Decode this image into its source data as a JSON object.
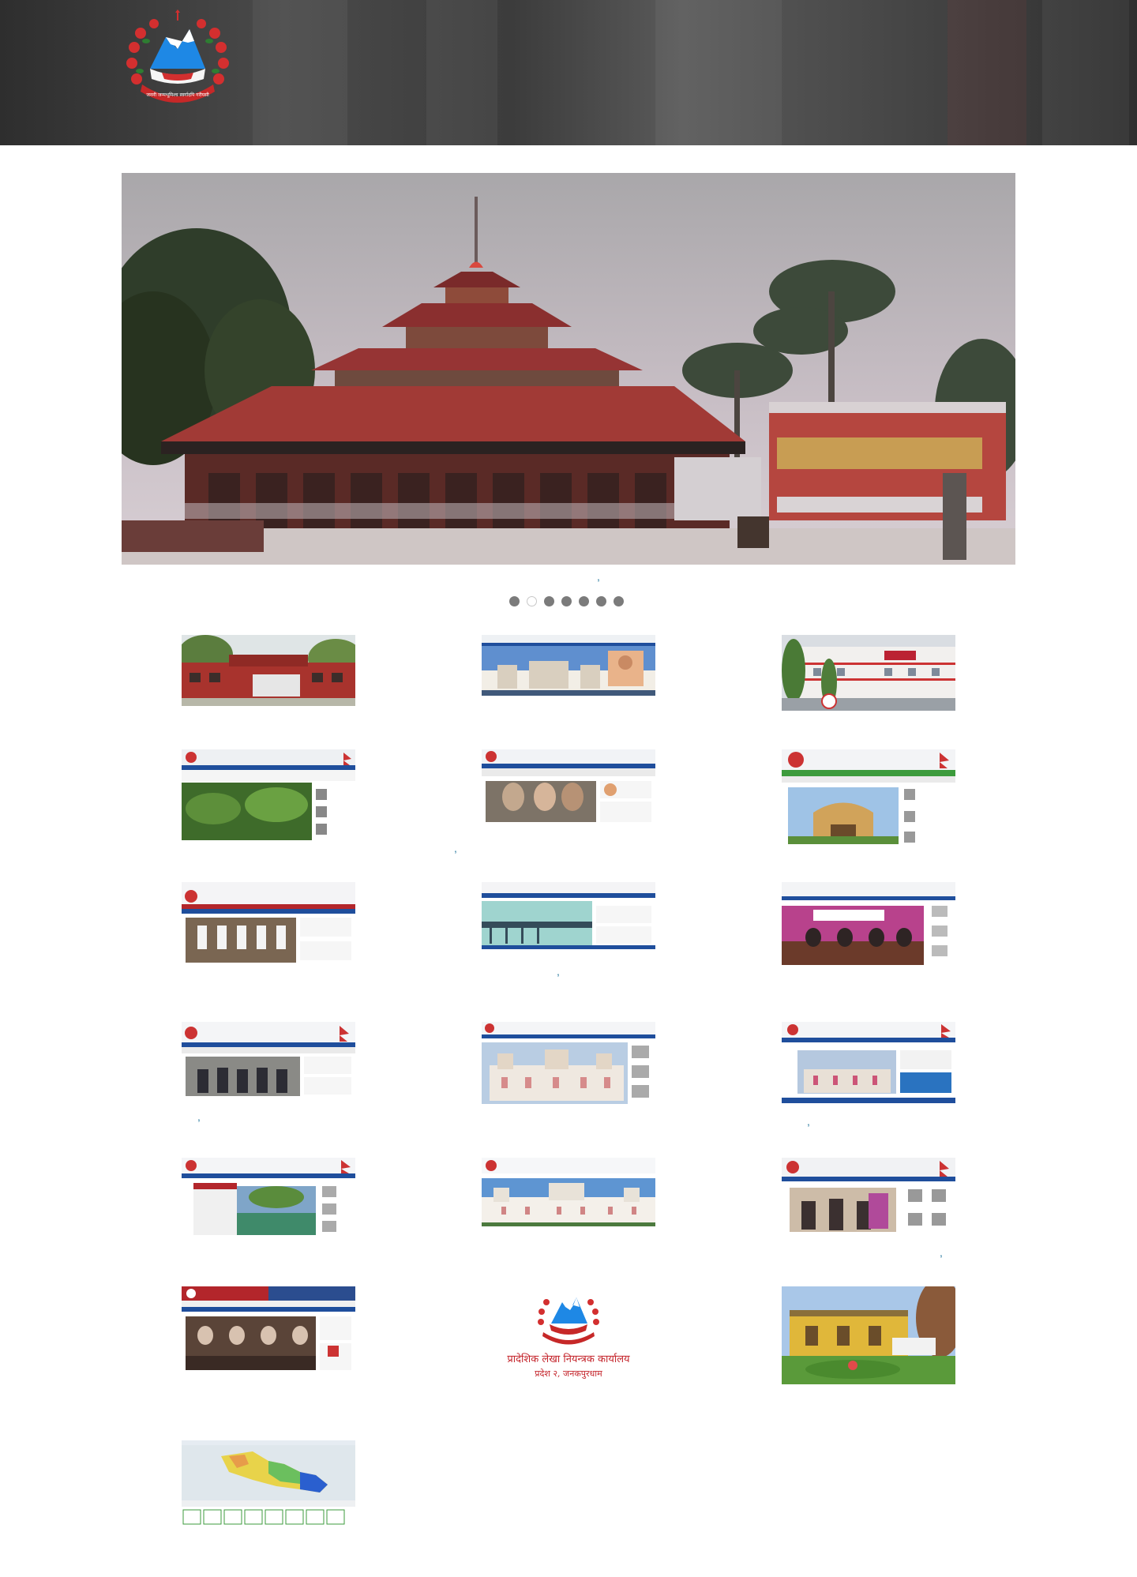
{
  "header": {
    "emblem_text": "प्रदेश सरकार"
  },
  "slider": {
    "dots": [
      false,
      true,
      false,
      false,
      false,
      false,
      false
    ]
  },
  "thumbnails": [
    {
      "id": "t1",
      "kind": "building-red"
    },
    {
      "id": "t2",
      "kind": "site-palace-blue"
    },
    {
      "id": "t3",
      "kind": "building-white"
    },
    {
      "id": "t4",
      "kind": "site-banana"
    },
    {
      "id": "t5",
      "kind": "site-people"
    },
    {
      "id": "t6",
      "kind": "site-gate-green"
    },
    {
      "id": "t7",
      "kind": "site-group-red"
    },
    {
      "id": "t8",
      "kind": "site-bridge"
    },
    {
      "id": "t9",
      "kind": "site-meeting"
    },
    {
      "id": "t10",
      "kind": "site-group-blue"
    },
    {
      "id": "t11",
      "kind": "site-palace-white"
    },
    {
      "id": "t12",
      "kind": "site-palace-blue2"
    },
    {
      "id": "t13",
      "kind": "site-pond"
    },
    {
      "id": "t14",
      "kind": "site-palace-day"
    },
    {
      "id": "t15",
      "kind": "site-officials"
    },
    {
      "id": "t16",
      "kind": "site-office-meeting"
    },
    {
      "id": "t17",
      "kind": "logo-accounts"
    },
    {
      "id": "t18",
      "kind": "building-yellow"
    },
    {
      "id": "t19",
      "kind": "site-map"
    }
  ],
  "accounts_logo": {
    "title": "प्रादेशिक लेखा नियन्त्रक कार्यालय",
    "subtitle": "प्रदेश २, जनकपुरधाम"
  },
  "colors": {
    "header_bg": "#3a3a3a",
    "dot_inactive": "#7b7b7b",
    "dot_active": "#ffffff",
    "accent_red": "#c4242b",
    "accent_blue": "#1f4e9c"
  }
}
